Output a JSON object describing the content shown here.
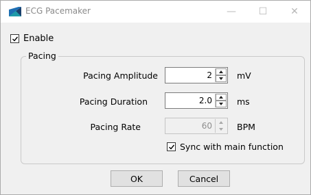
{
  "window": {
    "title": "ECG Pacemaker",
    "minimize_glyph": "—",
    "maximize_glyph": "☐",
    "close_glyph": "✕"
  },
  "enable": {
    "label": "Enable",
    "checked": true
  },
  "pacing": {
    "title": "Pacing",
    "amplitude": {
      "label": "Pacing Amplitude",
      "value": "2",
      "unit": "mV"
    },
    "duration": {
      "label": "Pacing Duration",
      "value": "2.0",
      "unit": "ms"
    },
    "rate": {
      "label": "Pacing Rate",
      "value": "60",
      "unit": "BPM",
      "enabled": false
    },
    "sync": {
      "label": "Sync with main function",
      "checked": true
    }
  },
  "buttons": {
    "ok": "OK",
    "cancel": "Cancel"
  },
  "colors": {
    "icon_blue": "#1e6fb3",
    "icon_dark": "#1b3f6b",
    "icon_teal": "#1f9aa8"
  },
  "icons": {
    "app": "ecg-app-icon",
    "check": "check-icon"
  }
}
